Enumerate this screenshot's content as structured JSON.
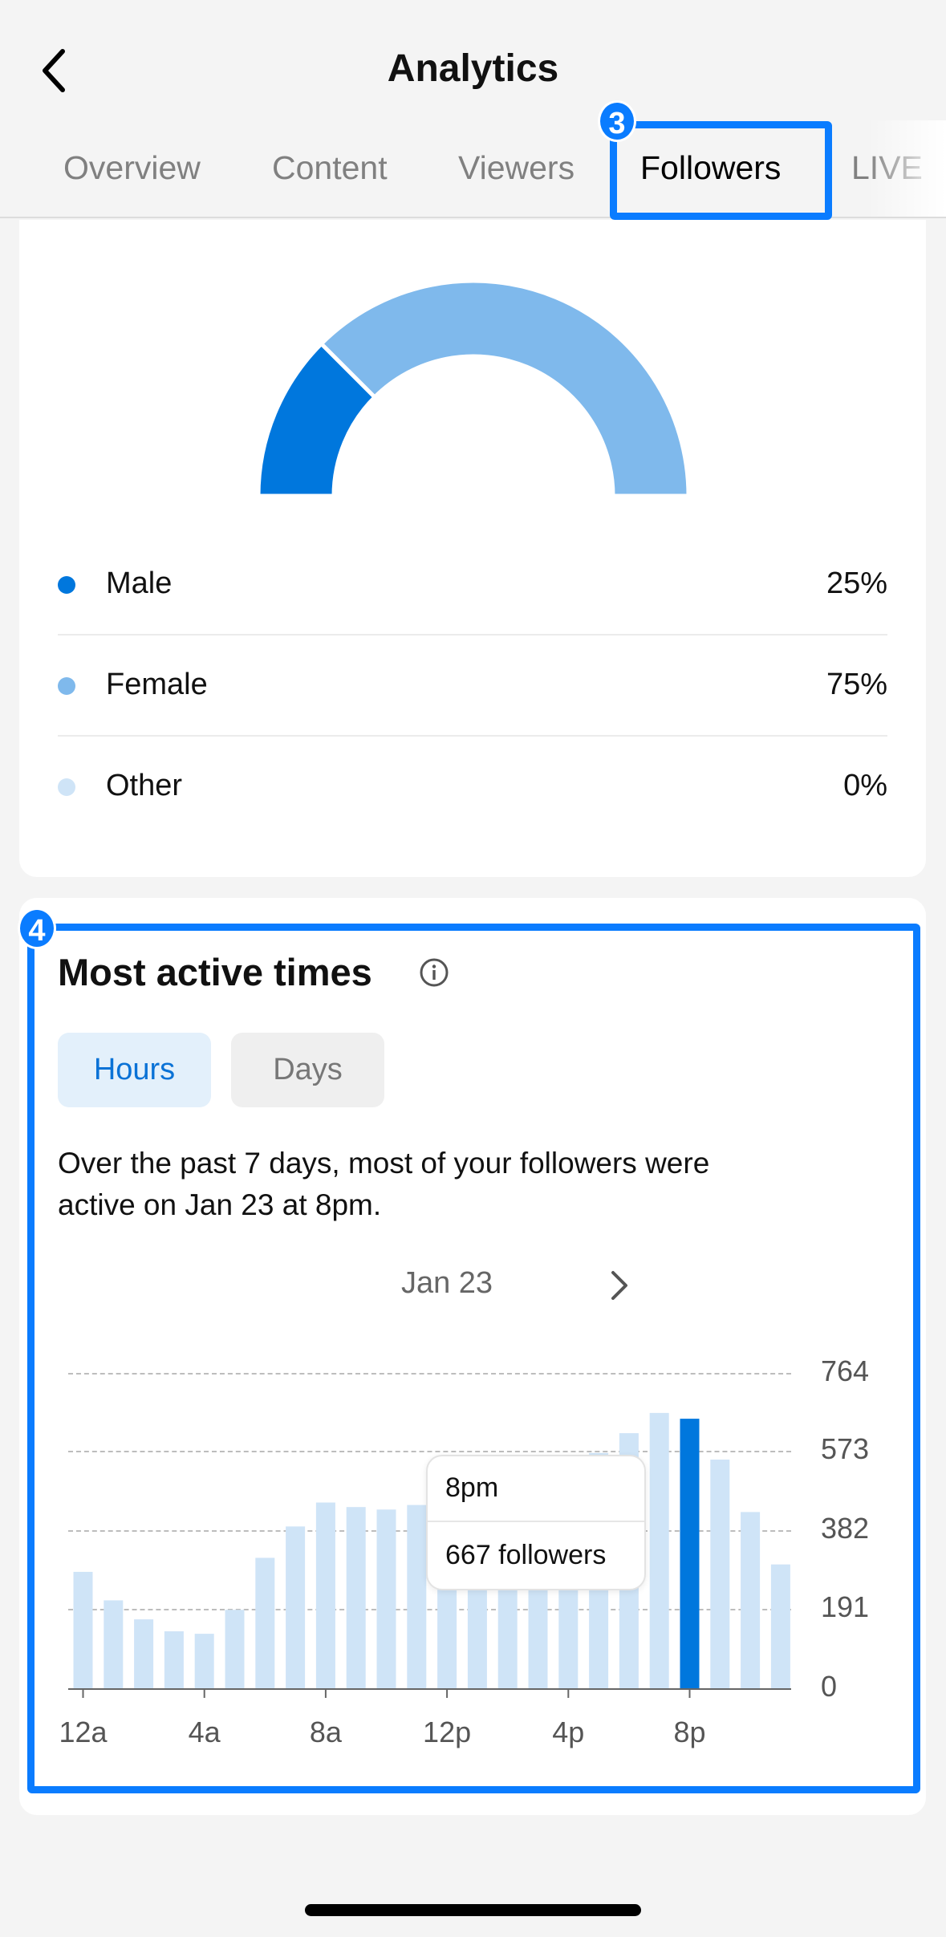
{
  "header": {
    "title": "Analytics",
    "tabs": [
      {
        "label": "Overview"
      },
      {
        "label": "Content"
      },
      {
        "label": "Viewers"
      },
      {
        "label": "Followers",
        "active": true
      },
      {
        "label": "LIVE"
      }
    ]
  },
  "annotations": {
    "badge_3": "3",
    "badge_4": "4",
    "color": "#0a7cff"
  },
  "gender": {
    "items": [
      {
        "label": "Male",
        "value": "25%",
        "color": "#0077dd"
      },
      {
        "label": "Female",
        "value": "75%",
        "color": "#7fb9ec"
      },
      {
        "label": "Other",
        "value": "0%",
        "color": "#cfe4f7"
      }
    ]
  },
  "active_times": {
    "title": "Most active times",
    "toggle": [
      {
        "label": "Hours",
        "active": true
      },
      {
        "label": "Days"
      }
    ],
    "summary_line1": "Over the past 7 days, most of your followers were",
    "summary_line2": "active on Jan 23 at 8pm.",
    "date": "Jan 23",
    "tooltip": {
      "time": "8pm",
      "count": "667 followers"
    }
  },
  "chart_data": {
    "type": "bar",
    "categories": [
      "12a",
      "1a",
      "2a",
      "3a",
      "4a",
      "5a",
      "6a",
      "7a",
      "8a",
      "9a",
      "10a",
      "11a",
      "12p",
      "1p",
      "2p",
      "3p",
      "4p",
      "5p",
      "6p",
      "7p",
      "8p",
      "9p",
      "10p",
      "11p"
    ],
    "x_tick_labels": [
      "12a",
      "4a",
      "8a",
      "12p",
      "4p",
      "8p"
    ],
    "y_tick_labels": [
      "764",
      "573",
      "382",
      "191",
      "0"
    ],
    "values": [
      282,
      213,
      167,
      138,
      132,
      190,
      316,
      392,
      450,
      439,
      433,
      444,
      440,
      455,
      470,
      485,
      500,
      570,
      618,
      667,
      653,
      554,
      427,
      300
    ],
    "ylim": [
      0,
      764
    ],
    "grid": true,
    "highlight_index": 20,
    "colors": {
      "bar": "#cfe4f7",
      "highlight": "#0077dd"
    }
  }
}
